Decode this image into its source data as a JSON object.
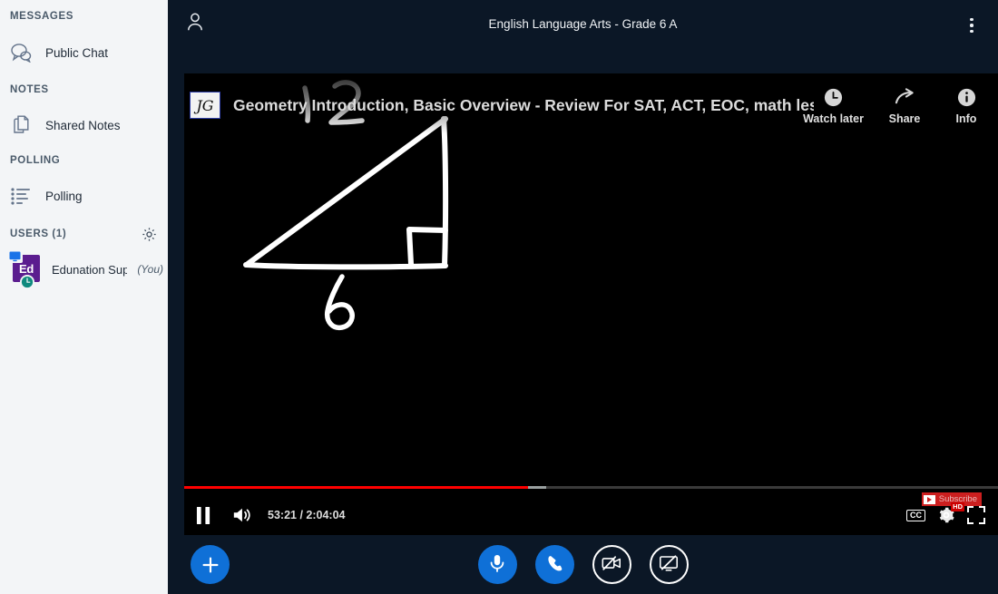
{
  "sidebar": {
    "sections": [
      {
        "label": "MESSAGES"
      },
      {
        "label": "NOTES"
      },
      {
        "label": "POLLING"
      }
    ],
    "items": [
      {
        "label": "Public Chat",
        "icon": "chat-bubbles-icon"
      },
      {
        "label": "Shared Notes",
        "icon": "documents-icon"
      },
      {
        "label": "Polling",
        "icon": "list-bullets-icon"
      }
    ],
    "users": {
      "header": "USERS (1)",
      "settings_icon": "gear-icon",
      "list": [
        {
          "initials": "Ed",
          "name": "Edunation Sup…",
          "you_label": "(You)",
          "avatar_color": "#5b1d8f",
          "presenter_badge_icon": "screen-share-icon",
          "status_badge_icon": "clock-status-icon"
        }
      ]
    }
  },
  "topbar": {
    "user_icon": "person-icon",
    "title": "English Language Arts - Grade 6 A",
    "menu_icon": "kebab-menu-icon"
  },
  "video": {
    "channel_initials": "JG",
    "title": "Geometry Introduction, Basic Overview - Review For SAT, ACT, EOC, math less…",
    "actions": [
      {
        "label": "Watch later",
        "icon": "clock-icon"
      },
      {
        "label": "Share",
        "icon": "share-arrow-icon"
      },
      {
        "label": "Info",
        "icon": "info-circle-icon"
      }
    ],
    "subscribe_label": "Subscribe",
    "whiteboard": {
      "hypotenuse_label": "12",
      "base_label": "6"
    },
    "controls": {
      "play_state_icon": "pause-icon",
      "volume_icon": "volume-on-icon",
      "time": "53:21 / 2:04:04",
      "current_time": "53:21",
      "duration": "2:04:04",
      "progress_percent": 42.3,
      "buffered_percent": 44.5,
      "cc_label": "CC",
      "quality_badge": "HD",
      "settings_icon": "gear-icon",
      "fullscreen_icon": "fullscreen-icon",
      "progress_color": "#ff0000"
    }
  },
  "actionbar": {
    "add_label": "+",
    "buttons": [
      {
        "name": "microphone",
        "icon": "microphone-icon",
        "state": "on"
      },
      {
        "name": "leave-audio",
        "icon": "phone-icon",
        "state": "on"
      },
      {
        "name": "camera",
        "icon": "camera-off-icon",
        "state": "off"
      },
      {
        "name": "screen-share",
        "icon": "screen-share-off-icon",
        "state": "off"
      }
    ],
    "accent_color": "#0f70d7"
  }
}
